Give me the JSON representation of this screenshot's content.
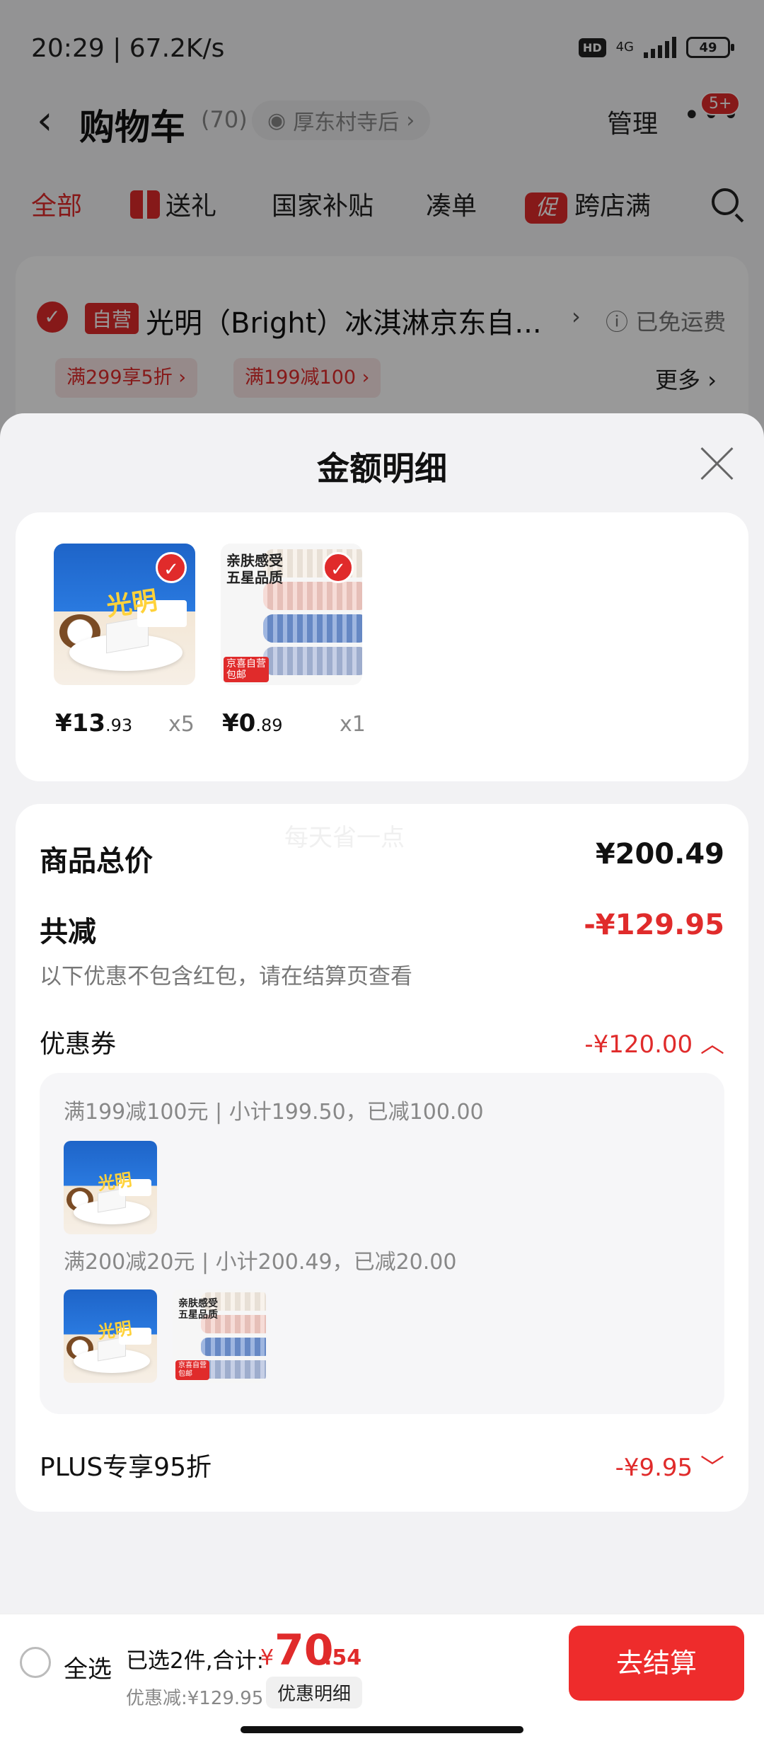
{
  "status": {
    "time": "20:29 | 67.2K/s",
    "hd": "HD",
    "network": "4G",
    "battery": "49"
  },
  "header": {
    "title": "购物车",
    "count": "(70)",
    "location": "厚东村寺后",
    "manage": "管理",
    "badge": "5+"
  },
  "tabs": [
    {
      "label": "全部",
      "active": true
    },
    {
      "label": "送礼",
      "icon": "gift-icon"
    },
    {
      "label": "国家补贴"
    },
    {
      "label": "凑单"
    },
    {
      "label": "跨店满",
      "icon_text": "促"
    }
  ],
  "shop": {
    "badge": "自营",
    "name": "光明（Bright）冰淇淋京东自...",
    "free_shipping": "已免运费",
    "promos": [
      "满299享5折 ›",
      "满199减100 ›"
    ],
    "more": "更多"
  },
  "sheet": {
    "title": "金额明细",
    "watermark": "每天省一点",
    "goods": [
      {
        "name": "光明 ice cream",
        "price_int": "¥13",
        "price_dec": ".93",
        "qty": "x5"
      },
      {
        "name": "towel",
        "price_int": "¥0",
        "price_dec": ".89",
        "qty": "x1",
        "text": "亲肤感受\n五星品质",
        "badge": "京喜自营\n包邮"
      }
    ],
    "total_label": "商品总价",
    "total_value": "¥200.49",
    "reduce_label": "共减",
    "reduce_value": "-¥129.95",
    "reduce_note": "以下优惠不包含红包，请在结算页查看",
    "coupon_label": "优惠券",
    "coupon_value": "-¥120.00",
    "coupon_lines": [
      "满199减100元 | 小计199.50，已减100.00",
      "满200减20元 | 小计200.49，已减20.00"
    ],
    "plus_label": "PLUS专享95折",
    "plus_value": "-¥9.95"
  },
  "bottom": {
    "select_all": "全选",
    "selected": "已选2件,合计:",
    "currency": "¥",
    "total_int": "70",
    "total_dec": ".54",
    "discount": "优惠减:¥129.95",
    "detail_chip": "优惠明细",
    "checkout": "去结算"
  },
  "colors": {
    "accent": "#e02b2b",
    "checkout": "#ee2c2c"
  }
}
